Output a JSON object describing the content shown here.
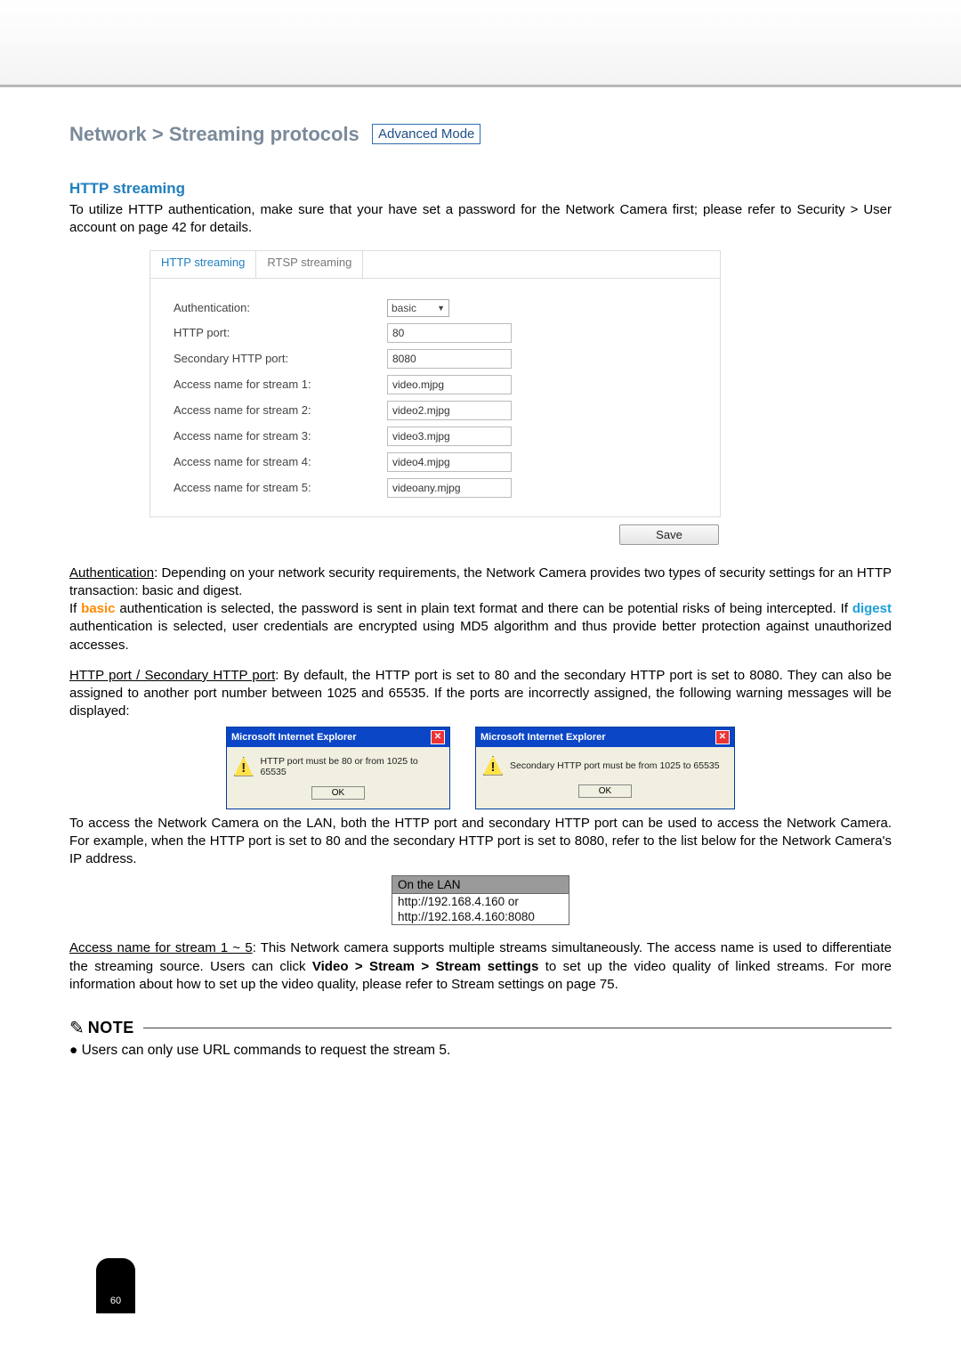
{
  "header": {
    "title": "Network > Streaming protocols",
    "mode_badge": "Advanced Mode"
  },
  "section": {
    "http_streaming_title": "HTTP streaming",
    "intro": "To utilize HTTP authentication, make sure that your have set a password for the Network Camera first; please refer to Security > User account on page 42 for details."
  },
  "tabs": {
    "http": "HTTP streaming",
    "rtsp": "RTSP streaming",
    "active": "http"
  },
  "form": {
    "auth_label": "Authentication:",
    "auth_value": "basic",
    "http_port_label": "HTTP port:",
    "http_port_value": "80",
    "sec_port_label": "Secondary HTTP port:",
    "sec_port_value": "8080",
    "s1_label": "Access name for stream 1:",
    "s1_value": "video.mjpg",
    "s2_label": "Access name for stream 2:",
    "s2_value": "video2.mjpg",
    "s3_label": "Access name for stream 3:",
    "s3_value": "video3.mjpg",
    "s4_label": "Access name for stream 4:",
    "s4_value": "video4.mjpg",
    "s5_label": "Access name for stream 5:",
    "s5_value": "videoany.mjpg",
    "save": "Save"
  },
  "paras": {
    "auth_lead": "Authentication",
    "auth_txt": ": Depending on your network security requirements, the Network Camera provides two types of security settings for an HTTP transaction: basic and digest.",
    "auth_txt2a": "If ",
    "auth_basic": "basic",
    "auth_txt2b": " authentication is selected, the password is sent in plain text format and there can be potential risks of being intercepted. If ",
    "auth_digest": "digest",
    "auth_txt2c": " authentication is selected, user credentials are encrypted using MD5 algorithm and thus provide better protection against unauthorized accesses.",
    "port_lead": "HTTP port / Secondary HTTP port",
    "port_txt": ": By default, the HTTP port is set to 80 and the secondary HTTP port is set to 8080. They can also be assigned to another port number between 1025 and 65535. If the ports are incorrectly assigned, the following warning messages will be displayed:",
    "lan_txt": "To access the Network Camera on the LAN, both the HTTP port and secondary HTTP port can be used to access the Network Camera. For example, when the HTTP port is set to 80 and the secondary HTTP port is set to 8080, refer to the list below for the Network Camera's IP address.",
    "accname_lead": "Access name for stream 1 ~ 5",
    "accname_txt": ": This Network camera supports multiple streams simultaneously. The access name is used to differentiate the streaming source. Users can click ",
    "accname_bold": "Video > Stream > Stream settings",
    "accname_txt2": " to set up the video quality of linked streams. For more information about how to set up the video quality, please refer to Stream settings on page 75."
  },
  "dialogs": {
    "title": "Microsoft Internet Explorer",
    "msg1": "HTTP port must be 80 or from 1025 to 65535",
    "msg2": "Secondary HTTP port must be from 1025 to 65535",
    "ok": "OK"
  },
  "lan": {
    "header": "On the LAN",
    "row1": "http://192.168.4.160  or",
    "row2": "http://192.168.4.160:8080"
  },
  "note": {
    "label": "NOTE",
    "bullet": "● Users can only use URL commands to request the stream 5."
  },
  "page_number": "60"
}
